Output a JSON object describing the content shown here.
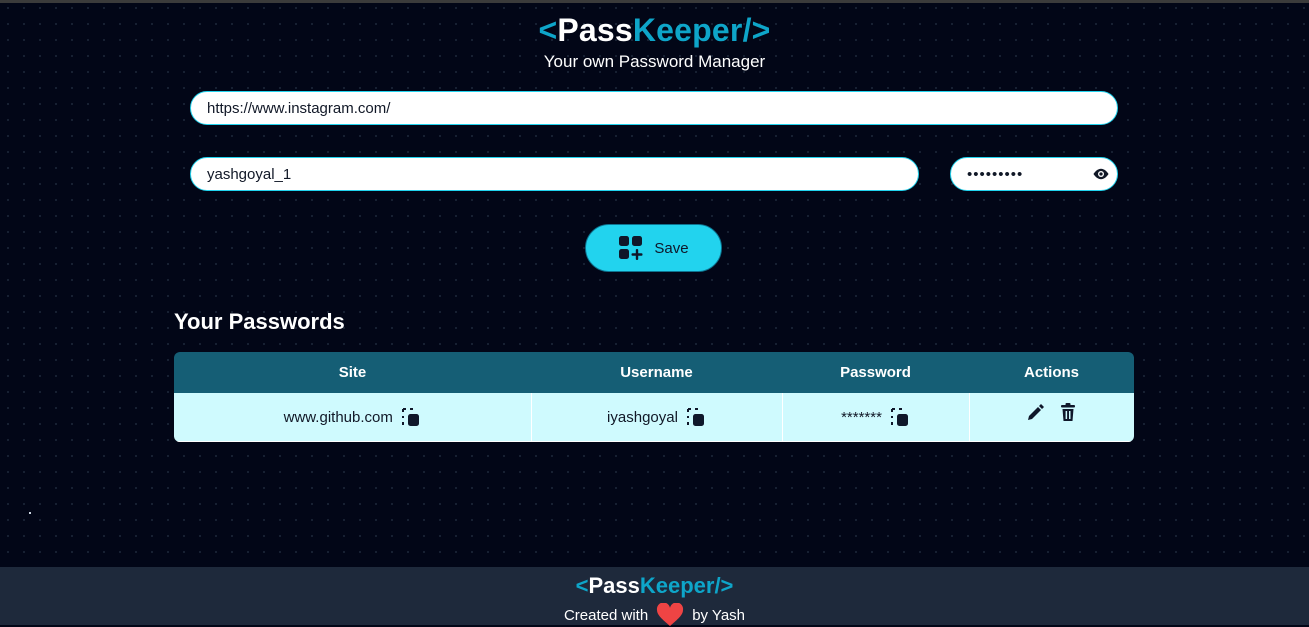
{
  "brand": {
    "open": "<",
    "pass": "Pass",
    "keeper": "Keeper",
    "close": "/>"
  },
  "subtitle": "Your own Password Manager",
  "form": {
    "site_value": "https://www.instagram.com/",
    "username_value": "yashgoyal_1",
    "password_value": "asdasdasd",
    "save_label": "Save"
  },
  "section_title": "Your Passwords",
  "table": {
    "headers": [
      "Site",
      "Username",
      "Password",
      "Actions"
    ],
    "rows": [
      {
        "site": "www.github.com",
        "username": "iyashgoyal",
        "password": "*******"
      }
    ]
  },
  "footer": {
    "brand": {
      "open": "<",
      "pass": "Pass",
      "keeper": "Keeper",
      "close": "/>"
    },
    "created_with": "Created with",
    "by": "by Yash"
  },
  "colors": {
    "accent": "#22d3ee",
    "brand": "#0ea5c9",
    "table_header": "#155e75",
    "table_row": "#cffafe",
    "heart": "#ef4444"
  },
  "icons": [
    "eye-icon",
    "add-grid-icon",
    "copy-icon",
    "edit-icon",
    "trash-icon",
    "heart-icon"
  ]
}
